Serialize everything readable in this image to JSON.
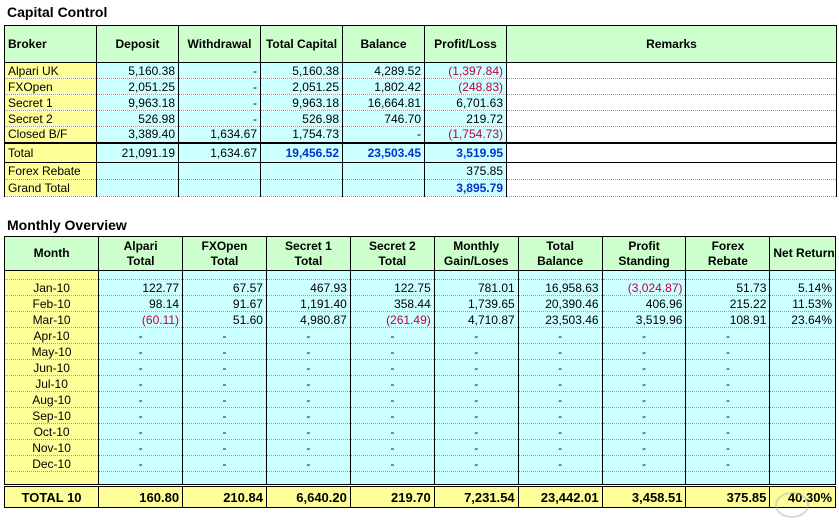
{
  "capital": {
    "title": "Capital Control",
    "headers": [
      "Broker",
      "Deposit",
      "Withdrawal",
      "Total Capital",
      "Balance",
      "Profit/Loss",
      "Remarks"
    ],
    "rows": [
      {
        "broker": "Alpari UK",
        "deposit": "5,160.38",
        "withdrawal": "-",
        "total": "5,160.38",
        "balance": "4,289.52",
        "pl": "(1,397.84)",
        "pl_neg": true
      },
      {
        "broker": "FXOpen",
        "deposit": "2,051.25",
        "withdrawal": "-",
        "total": "2,051.25",
        "balance": "1,802.42",
        "pl": "(248.83)",
        "pl_neg": true
      },
      {
        "broker": "Secret 1",
        "deposit": "9,963.18",
        "withdrawal": "-",
        "total": "9,963.18",
        "balance": "16,664.81",
        "pl": "6,701.63",
        "pl_neg": false
      },
      {
        "broker": "Secret 2",
        "deposit": "526.98",
        "withdrawal": "-",
        "total": "526.98",
        "balance": "746.70",
        "pl": "219.72",
        "pl_neg": false
      },
      {
        "broker": "Closed B/F",
        "deposit": "3,389.40",
        "withdrawal": "1,634.67",
        "total": "1,754.73",
        "balance": "-",
        "pl": "(1,754.73)",
        "pl_neg": true
      }
    ],
    "total": {
      "label": "Total",
      "deposit": "21,091.19",
      "withdrawal": "1,634.67",
      "total": "19,456.52",
      "balance": "23,503.45",
      "pl": "3,519.95"
    },
    "rebate": {
      "label": "Forex Rebate",
      "value": "375.85"
    },
    "grand": {
      "label": "Grand Total",
      "value": "3,895.79"
    }
  },
  "monthly": {
    "title": "Monthly Overview",
    "headers": [
      [
        "Month",
        ""
      ],
      [
        "Alpari",
        "Total"
      ],
      [
        "FXOpen",
        "Total"
      ],
      [
        "Secret 1",
        "Total"
      ],
      [
        "Secret 2",
        "Total"
      ],
      [
        "Monthly",
        "Gain/Loses"
      ],
      [
        "Total",
        "Balance"
      ],
      [
        "Profit",
        "Standing"
      ],
      [
        "Forex",
        "Rebate"
      ],
      [
        "Net Return",
        ""
      ]
    ],
    "rows": [
      {
        "month": "Jan-10",
        "c": [
          "122.77",
          "67.57",
          "467.93",
          "122.75",
          "781.01",
          "16,958.63",
          "(3,024.87)",
          "51.73",
          "5.14%"
        ],
        "neg": [
          false,
          false,
          false,
          false,
          false,
          false,
          true,
          false,
          false
        ]
      },
      {
        "month": "Feb-10",
        "c": [
          "98.14",
          "91.67",
          "1,191.40",
          "358.44",
          "1,739.65",
          "20,390.46",
          "406.96",
          "215.22",
          "11.53%"
        ],
        "neg": [
          false,
          false,
          false,
          false,
          false,
          false,
          false,
          false,
          false
        ]
      },
      {
        "month": "Mar-10",
        "c": [
          "(60.11)",
          "51.60",
          "4,980.87",
          "(261.49)",
          "4,710.87",
          "23,503.46",
          "3,519.96",
          "108.91",
          "23.64%"
        ],
        "neg": [
          true,
          false,
          false,
          true,
          false,
          false,
          false,
          false,
          false
        ]
      },
      {
        "month": "Apr-10",
        "c": [
          "-",
          "-",
          "-",
          "-",
          "-",
          "-",
          "-",
          "-",
          ""
        ],
        "neg": []
      },
      {
        "month": "May-10",
        "c": [
          "-",
          "-",
          "-",
          "-",
          "-",
          "-",
          "-",
          "-",
          ""
        ],
        "neg": []
      },
      {
        "month": "Jun-10",
        "c": [
          "-",
          "-",
          "-",
          "-",
          "-",
          "-",
          "-",
          "-",
          ""
        ],
        "neg": []
      },
      {
        "month": "Jul-10",
        "c": [
          "-",
          "-",
          "-",
          "-",
          "-",
          "-",
          "-",
          "-",
          ""
        ],
        "neg": []
      },
      {
        "month": "Aug-10",
        "c": [
          "-",
          "-",
          "-",
          "-",
          "-",
          "-",
          "-",
          "-",
          ""
        ],
        "neg": []
      },
      {
        "month": "Sep-10",
        "c": [
          "-",
          "-",
          "-",
          "-",
          "-",
          "-",
          "-",
          "-",
          ""
        ],
        "neg": []
      },
      {
        "month": "Oct-10",
        "c": [
          "-",
          "-",
          "-",
          "-",
          "-",
          "-",
          "-",
          "-",
          ""
        ],
        "neg": []
      },
      {
        "month": "Nov-10",
        "c": [
          "-",
          "-",
          "-",
          "-",
          "-",
          "-",
          "-",
          "-",
          ""
        ],
        "neg": []
      },
      {
        "month": "Dec-10",
        "c": [
          "-",
          "-",
          "-",
          "-",
          "-",
          "-",
          "-",
          "-",
          ""
        ],
        "neg": []
      }
    ],
    "footer": {
      "label": "TOTAL 10",
      "c": [
        "160.80",
        "210.84",
        "6,640.20",
        "219.70",
        "7,231.54",
        "23,442.01",
        "3,458.51",
        "375.85",
        "40.30%"
      ]
    }
  },
  "colors": {
    "header": "#ccffcc",
    "name": "#ffff99",
    "number": "#ccffff",
    "negative": "#c0003c",
    "highlight": "#0033cc"
  }
}
